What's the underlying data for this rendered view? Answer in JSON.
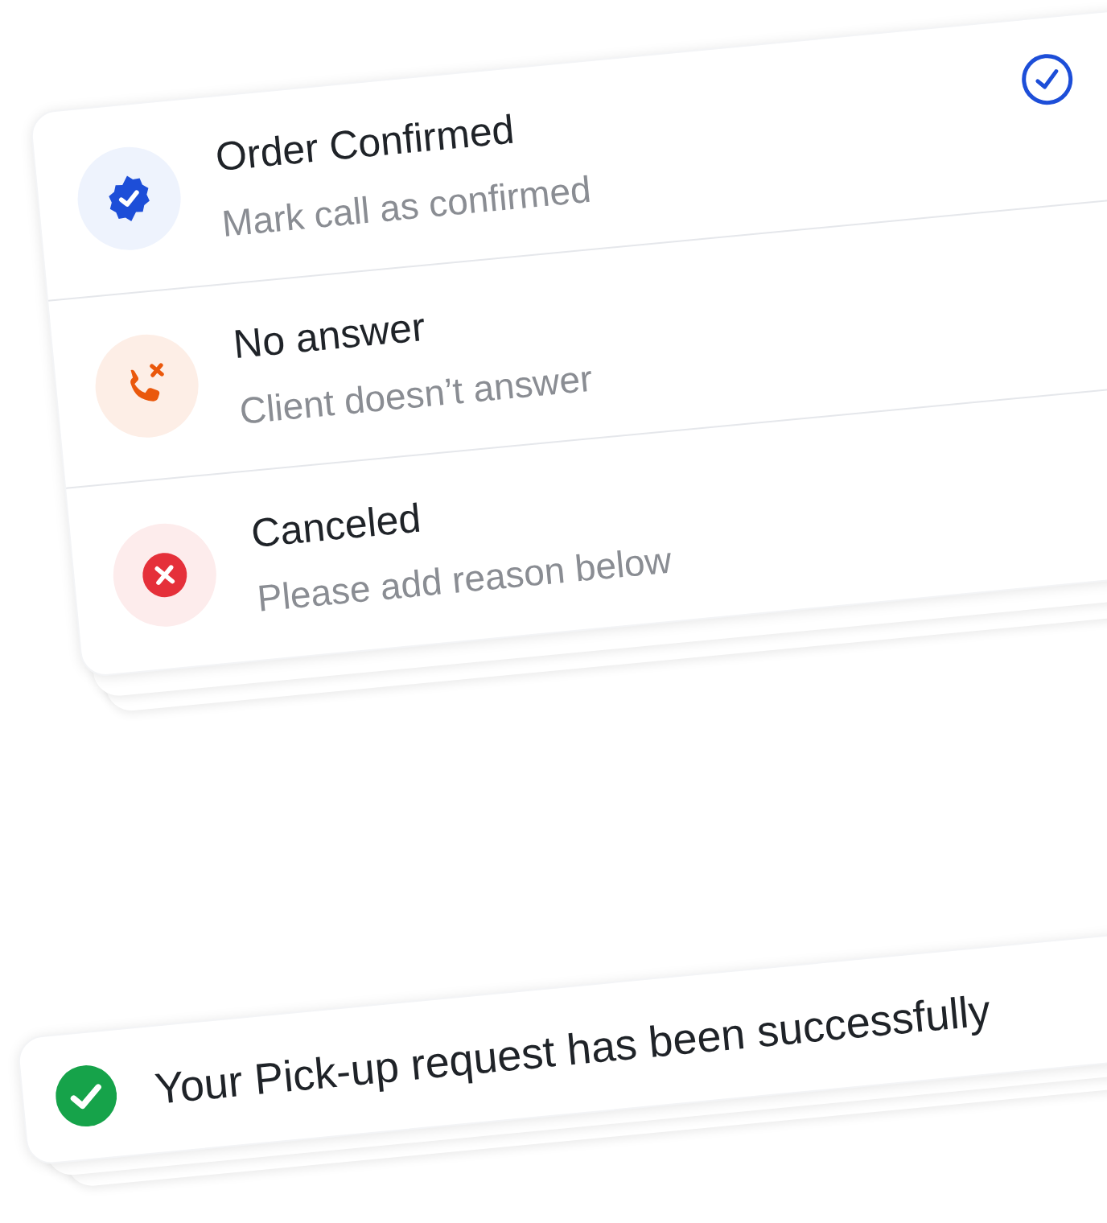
{
  "status_options": [
    {
      "kind": "confirmed",
      "title": "Order Confirmed",
      "subtitle": "Mark call as confirmed",
      "selected": true
    },
    {
      "kind": "no_answer",
      "title": "No answer",
      "subtitle": "Client doesn’t answer",
      "selected": false
    },
    {
      "kind": "canceled",
      "title": "Canceled",
      "subtitle": "Please add reason below",
      "selected": false
    }
  ],
  "toast": {
    "kind": "success",
    "message": "Your Pick-up request has been successfully"
  }
}
